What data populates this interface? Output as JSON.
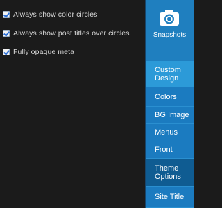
{
  "options": [
    {
      "label": "Always show color circles",
      "checked": true
    },
    {
      "label": "Always show post titles over circles",
      "checked": true
    },
    {
      "label": "Fully opaque meta",
      "checked": true
    }
  ],
  "sidebar": {
    "snapshots": {
      "label": "Snapshots",
      "icon": "camera-icon"
    },
    "items": [
      {
        "label": "Custom Design",
        "style": "light"
      },
      {
        "label": "Colors",
        "style": "mid"
      },
      {
        "label": "BG Image",
        "style": "mid"
      },
      {
        "label": "Menus",
        "style": "mid"
      },
      {
        "label": "Front",
        "style": "mid"
      },
      {
        "label": "Theme Options",
        "style": "dark"
      },
      {
        "label": "Site Title",
        "style": "mid"
      }
    ]
  },
  "colors": {
    "background": "#1b1b1b",
    "sidebar_light": "#2c9ad8",
    "sidebar_mid": "#1b7bc0",
    "sidebar_dark": "#0f5c92",
    "snapshots_bg": "#1f7fbf"
  }
}
